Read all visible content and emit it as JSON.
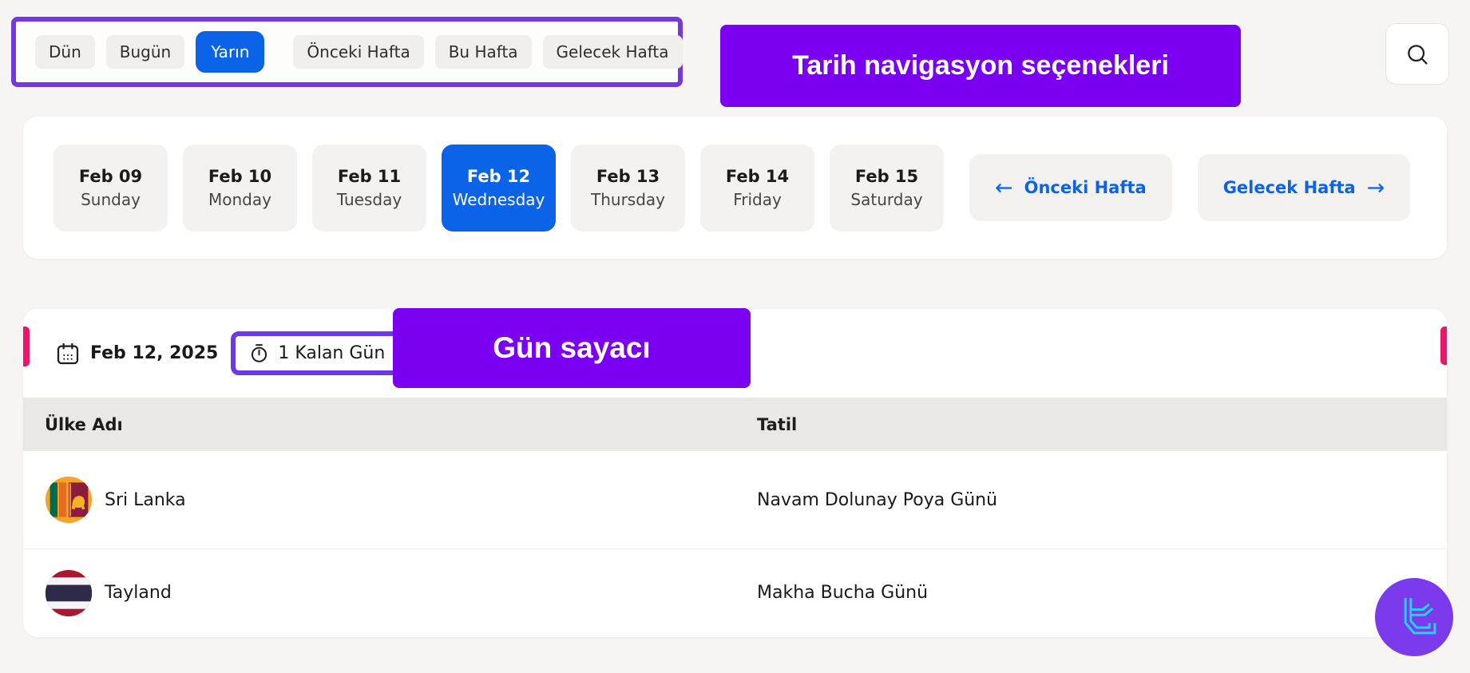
{
  "colors": {
    "page_background": "#F7F5F3",
    "accent_blue": "#0B63E8",
    "annotation_purple_fill": "#7B00F2",
    "annotation_purple_border_light": "#7438DB",
    "annotation_purple_border_dark": "#6D3ADF",
    "accent_pink": "#EC1566",
    "logo_purple": "#7B3BEC",
    "logo_cyan": "#1BD7F5"
  },
  "top_bar": {
    "annotation_label": "Tarih navigasyon seçenekleri",
    "filters": [
      {
        "label": "Dün",
        "active": false
      },
      {
        "label": "Bugün",
        "active": false
      },
      {
        "label": "Yarın",
        "active": true
      },
      {
        "label": "Önceki Hafta",
        "active": false
      },
      {
        "label": "Bu Hafta",
        "active": false
      },
      {
        "label": "Gelecek Hafta",
        "active": false
      }
    ],
    "search_icon": "search-icon"
  },
  "week_strip": {
    "days": [
      {
        "date": "Feb 09",
        "weekday": "Sunday",
        "active": false
      },
      {
        "date": "Feb 10",
        "weekday": "Monday",
        "active": false
      },
      {
        "date": "Feb 11",
        "weekday": "Tuesday",
        "active": false
      },
      {
        "date": "Feb 12",
        "weekday": "Wednesday",
        "active": true
      },
      {
        "date": "Feb 13",
        "weekday": "Thursday",
        "active": false
      },
      {
        "date": "Feb 14",
        "weekday": "Friday",
        "active": false
      },
      {
        "date": "Feb 15",
        "weekday": "Saturday",
        "active": false
      }
    ],
    "prev": {
      "arrow": "←",
      "label": "Önceki Hafta"
    },
    "next": {
      "label": "Gelecek Hafta",
      "arrow": "→"
    }
  },
  "holiday_card": {
    "date": "Feb 12, 2025",
    "countdown": "1 Kalan Gün",
    "annotation_label": "Gün sayacı",
    "calendar_icon": "calendar-icon",
    "countdown_icon": "stopwatch-icon",
    "table": {
      "headers": {
        "country": "Ülke Adı",
        "holiday": "Tatil"
      },
      "rows": [
        {
          "country": "Sri Lanka",
          "holiday": "Navam Dolunay Poya Günü",
          "flag": "sri-lanka-flag"
        },
        {
          "country": "Tayland",
          "holiday": "Makha Bucha Günü",
          "flag": "thailand-flag"
        }
      ]
    }
  }
}
